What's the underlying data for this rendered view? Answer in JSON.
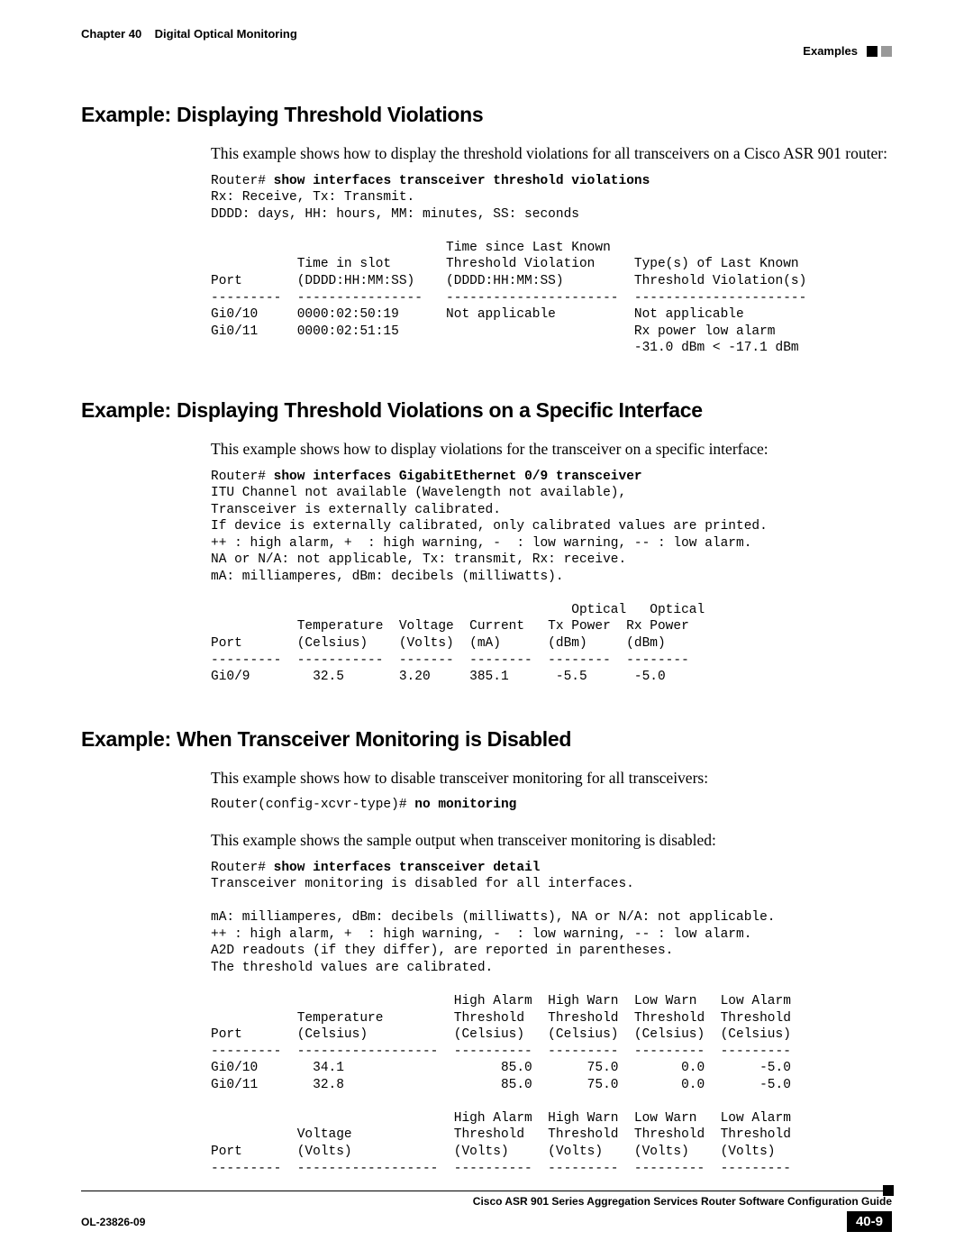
{
  "header": {
    "chapter_label": "Chapter 40",
    "chapter_title_suffix": "Digital Optical Monitoring",
    "breadcrumb": "Examples"
  },
  "sections": {
    "s1": {
      "heading": "Example: Displaying Threshold Violations",
      "intro": "This example shows how to display the threshold violations for all transceivers on a Cisco ASR 901 router:",
      "cli_prompt": "Router# ",
      "cli_cmd": "show interfaces transceiver threshold violations",
      "cli_output": "Rx: Receive, Tx: Transmit.\nDDDD: days, HH: hours, MM: minutes, SS: seconds\n\n                              Time since Last Known\n           Time in slot       Threshold Violation     Type(s) of Last Known\nPort       (DDDD:HH:MM:SS)    (DDDD:HH:MM:SS)         Threshold Violation(s)\n---------  ----------------   ----------------------  ----------------------\nGi0/10     0000:02:50:19      Not applicable          Not applicable\nGi0/11     0000:02:51:15                              Rx power low alarm\n                                                      -31.0 dBm < -17.1 dBm"
    },
    "s2": {
      "heading": "Example: Displaying Threshold Violations on a Specific Interface",
      "intro": "This example shows how to display violations for the transceiver on a specific interface:",
      "cli_prompt": "Router# ",
      "cli_cmd": "show interfaces GigabitEthernet 0/9 transceiver",
      "cli_output": "ITU Channel not available (Wavelength not available),\nTransceiver is externally calibrated.\nIf device is externally calibrated, only calibrated values are printed.\n++ : high alarm, +  : high warning, -  : low warning, -- : low alarm.\nNA or N/A: not applicable, Tx: transmit, Rx: receive.\nmA: milliamperes, dBm: decibels (milliwatts).\n\n                                              Optical   Optical\n           Temperature  Voltage  Current   Tx Power  Rx Power\nPort       (Celsius)    (Volts)  (mA)      (dBm)     (dBm)\n---------  -----------  -------  --------  --------  --------\nGi0/9        32.5       3.20     385.1      -5.5      -5.0"
    },
    "s3": {
      "heading": "Example: When Transceiver Monitoring is Disabled",
      "intro1": "This example shows how to disable transceiver monitoring for all transceivers:",
      "cli_prompt_a": "Router(config-xcvr-type)# ",
      "cli_cmd_a": "no monitoring",
      "intro2": "This example shows the sample output when transceiver monitoring is disabled:",
      "cli_prompt_b": "Router# ",
      "cli_cmd_b": "show interfaces transceiver detail",
      "cli_output_b": "Transceiver monitoring is disabled for all interfaces.\n\nmA: milliamperes, dBm: decibels (milliwatts), NA or N/A: not applicable.\n++ : high alarm, +  : high warning, -  : low warning, -- : low alarm.\nA2D readouts (if they differ), are reported in parentheses.\nThe threshold values are calibrated.\n\n                               High Alarm  High Warn  Low Warn   Low Alarm\n           Temperature         Threshold   Threshold  Threshold  Threshold\nPort       (Celsius)           (Celsius)   (Celsius)  (Celsius)  (Celsius)\n---------  ------------------  ----------  ---------  ---------  ---------\nGi0/10       34.1                    85.0       75.0        0.0       -5.0\nGi0/11       32.8                    85.0       75.0        0.0       -5.0\n\n                               High Alarm  High Warn  Low Warn   Low Alarm\n           Voltage             Threshold   Threshold  Threshold  Threshold\nPort       (Volts)             (Volts)     (Volts)    (Volts)    (Volts)\n---------  ------------------  ----------  ---------  ---------  ---------"
    }
  },
  "footer": {
    "guide_title": "Cisco ASR 901 Series Aggregation Services Router Software Configuration Guide",
    "doc_id": "OL-23826-09",
    "page_number": "40-9"
  }
}
